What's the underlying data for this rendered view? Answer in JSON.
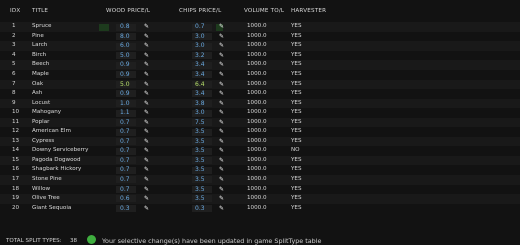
{
  "headers": {
    "idx": "IDX",
    "title": "TITLE",
    "wood": "WOOD PRICE/L",
    "chips": "CHIPS PRICE/L",
    "volume": "VOLUME TO/L",
    "harvester": "HARVESTER"
  },
  "rows": [
    {
      "idx": "1",
      "title": "Spruce",
      "wood": "0.8",
      "chips": "0.7",
      "volume": "1000.0",
      "harvester": "YES"
    },
    {
      "idx": "2",
      "title": "Pine",
      "wood": "8.0",
      "chips": "3.0",
      "volume": "1000.0",
      "harvester": "YES"
    },
    {
      "idx": "3",
      "title": "Larch",
      "wood": "6.0",
      "chips": "3.0",
      "volume": "1000.0",
      "harvester": "YES"
    },
    {
      "idx": "4",
      "title": "Birch",
      "wood": "5.0",
      "chips": "3.2",
      "volume": "1000.0",
      "harvester": "YES"
    },
    {
      "idx": "5",
      "title": "Beech",
      "wood": "0.9",
      "chips": "3.4",
      "volume": "1000.0",
      "harvester": "YES"
    },
    {
      "idx": "6",
      "title": "Maple",
      "wood": "0.9",
      "chips": "3.4",
      "volume": "1000.0",
      "harvester": "YES"
    },
    {
      "idx": "7",
      "title": "Oak",
      "wood": "5.0",
      "chips": "6.4",
      "volume": "1000.0",
      "harvester": "YES"
    },
    {
      "idx": "8",
      "title": "Ash",
      "wood": "0.9",
      "chips": "3.4",
      "volume": "1000.0",
      "harvester": "YES"
    },
    {
      "idx": "9",
      "title": "Locust",
      "wood": "1.0",
      "chips": "3.8",
      "volume": "1000.0",
      "harvester": "YES"
    },
    {
      "idx": "10",
      "title": "Mahogany",
      "wood": "1.1",
      "chips": "3.0",
      "volume": "1000.0",
      "harvester": "YES"
    },
    {
      "idx": "11",
      "title": "Poplar",
      "wood": "0.7",
      "chips": "7.5",
      "volume": "1000.0",
      "harvester": "YES"
    },
    {
      "idx": "12",
      "title": "American Elm",
      "wood": "0.7",
      "chips": "3.5",
      "volume": "1000.0",
      "harvester": "YES"
    },
    {
      "idx": "13",
      "title": "Cypress",
      "wood": "0.7",
      "chips": "3.5",
      "volume": "1000.0",
      "harvester": "YES"
    },
    {
      "idx": "14",
      "title": "Downy Serviceberry",
      "wood": "0.7",
      "chips": "3.5",
      "volume": "1000.0",
      "harvester": "NO"
    },
    {
      "idx": "15",
      "title": "Pagoda Dogwood",
      "wood": "0.7",
      "chips": "3.5",
      "volume": "1000.0",
      "harvester": "YES"
    },
    {
      "idx": "16",
      "title": "Shagbark Hickory",
      "wood": "0.7",
      "chips": "3.5",
      "volume": "1000.0",
      "harvester": "YES"
    },
    {
      "idx": "17",
      "title": "Stone Pine",
      "wood": "0.7",
      "chips": "3.5",
      "volume": "1000.0",
      "harvester": "YES"
    },
    {
      "idx": "18",
      "title": "Willow",
      "wood": "0.7",
      "chips": "3.5",
      "volume": "1000.0",
      "harvester": "YES"
    },
    {
      "idx": "19",
      "title": "Olive Tree",
      "wood": "0.6",
      "chips": "3.5",
      "volume": "1000.0",
      "harvester": "YES"
    },
    {
      "idx": "20",
      "title": "Giant Sequoia",
      "wood": "0.3",
      "chips": "0.3",
      "volume": "1000.0",
      "harvester": "YES"
    }
  ],
  "changed": {
    "wood": [
      "7"
    ],
    "chips": [
      "7"
    ]
  },
  "footer": {
    "total_label": "TOTAL SPLIT TYPES:",
    "total_value": "38",
    "message": "Your selective change(s) have been updated in game SplitType table"
  },
  "colors": {
    "value": "#6aa9e0",
    "changed": "#b7e06a",
    "ok": "#3fae3f"
  },
  "icons": {
    "edit": "pencil-icon",
    "status": "check-circle-icon"
  }
}
